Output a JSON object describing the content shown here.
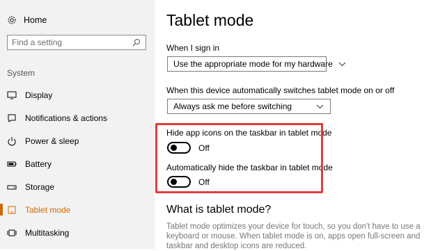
{
  "sidebar": {
    "home_label": "Home",
    "search_placeholder": "Find a setting",
    "section_title": "System",
    "items": [
      {
        "label": "Display",
        "icon": "display-icon"
      },
      {
        "label": "Notifications & actions",
        "icon": "notifications-icon"
      },
      {
        "label": "Power & sleep",
        "icon": "power-icon"
      },
      {
        "label": "Battery",
        "icon": "battery-icon"
      },
      {
        "label": "Storage",
        "icon": "storage-icon"
      },
      {
        "label": "Tablet mode",
        "icon": "tablet-mode-icon",
        "active": true
      },
      {
        "label": "Multitasking",
        "icon": "multitasking-icon"
      }
    ]
  },
  "main": {
    "title": "Tablet mode",
    "signin_label": "When I sign in",
    "signin_value": "Use the appropriate mode for my hardware",
    "switch_label": "When this device automatically switches tablet mode on or off",
    "switch_value": "Always ask me before switching",
    "hide_icons_label": "Hide app icons on the taskbar in tablet mode",
    "hide_icons_state": "Off",
    "hide_taskbar_label": "Automatically hide the taskbar in tablet mode",
    "hide_taskbar_state": "Off",
    "what_title": "What is tablet mode?",
    "what_body": "Tablet mode optimizes your device for touch, so you don't have to use a keyboard or mouse. When tablet mode is on, apps open full-screen and taskbar and desktop icons are reduced."
  },
  "colors": {
    "accent": "#d06a00",
    "highlight_border": "#e33b3b",
    "sidebar_bg": "#f2f2f2"
  }
}
